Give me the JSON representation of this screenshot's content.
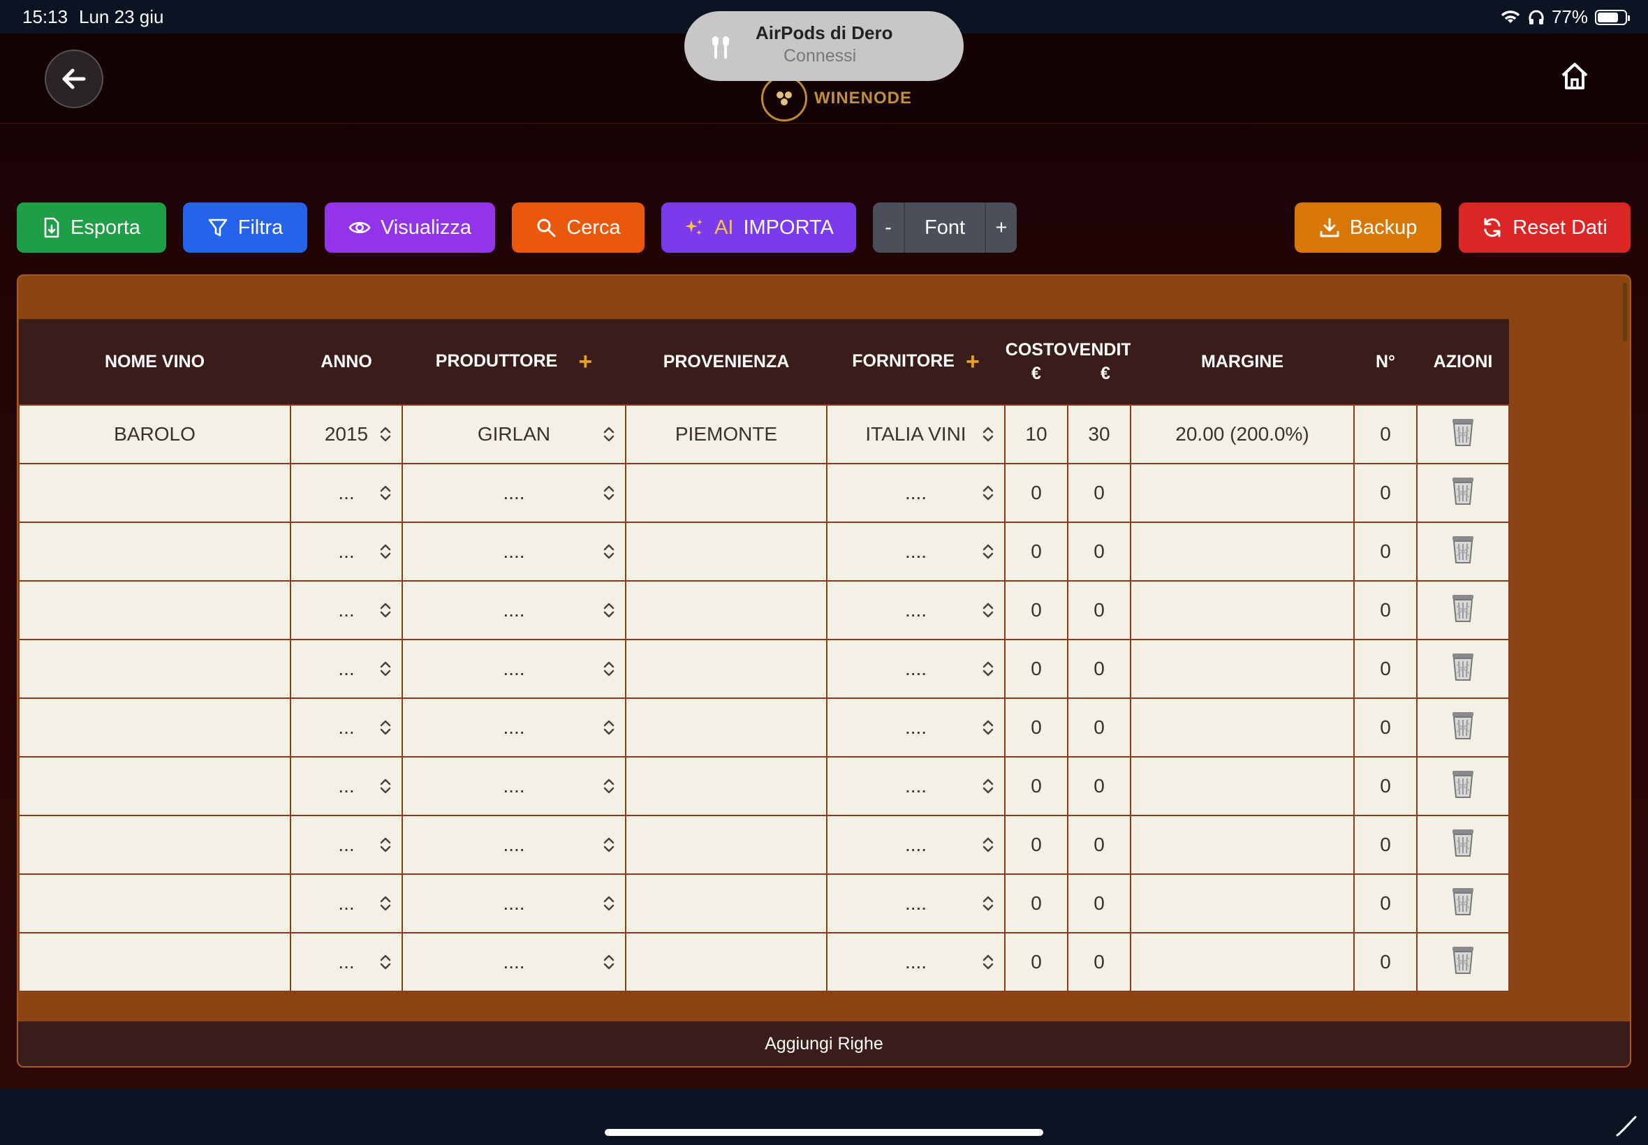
{
  "status_bar": {
    "time": "15:13",
    "date": "Lun 23 giu",
    "battery": "77%"
  },
  "notification": {
    "title": "AirPods di Dero",
    "subtitle": "Connessi"
  },
  "header": {
    "logo_text": "WINENODE"
  },
  "toolbar": {
    "export": "Esporta",
    "filter": "Filtra",
    "view": "Visualizza",
    "search": "Cerca",
    "ai_prefix": "AI",
    "import": "IMPORTA",
    "font_minus": "-",
    "font_label": "Font",
    "font_plus": "+",
    "backup": "Backup",
    "reset": "Reset Dati"
  },
  "colors": {
    "export": "#1e9e46",
    "filter": "#2563eb",
    "view": "#9333ea",
    "search": "#ea580c",
    "import": "#7c3aed",
    "backup": "#d97706",
    "reset": "#dc2626"
  },
  "table": {
    "headers": {
      "name": "NOME VINO",
      "year": "ANNO",
      "producer": "PRODUTTORE",
      "origin": "PROVENIENZA",
      "supplier": "FORNITORE",
      "cost_line1": "COSTO",
      "cost_line2": "€",
      "sale_line1": "VENDITA",
      "sale_line2": "€",
      "margin": "MARGINE",
      "qty": "N°",
      "actions": "AZIONI"
    },
    "add_symbol": "+",
    "rows": [
      {
        "name": "BAROLO",
        "year": "2015",
        "producer": "GIRLAN",
        "origin": "PIEMONTE",
        "supplier": "ITALIA VINI",
        "cost": "10",
        "sale": "30",
        "margin": "20.00 (200.0%)",
        "qty": "0"
      },
      {
        "name": "",
        "year": "...",
        "producer": "....",
        "origin": "",
        "supplier": "....",
        "cost": "0",
        "sale": "0",
        "margin": "",
        "qty": "0"
      },
      {
        "name": "",
        "year": "...",
        "producer": "....",
        "origin": "",
        "supplier": "....",
        "cost": "0",
        "sale": "0",
        "margin": "",
        "qty": "0"
      },
      {
        "name": "",
        "year": "...",
        "producer": "....",
        "origin": "",
        "supplier": "....",
        "cost": "0",
        "sale": "0",
        "margin": "",
        "qty": "0"
      },
      {
        "name": "",
        "year": "...",
        "producer": "....",
        "origin": "",
        "supplier": "....",
        "cost": "0",
        "sale": "0",
        "margin": "",
        "qty": "0"
      },
      {
        "name": "",
        "year": "...",
        "producer": "....",
        "origin": "",
        "supplier": "....",
        "cost": "0",
        "sale": "0",
        "margin": "",
        "qty": "0"
      },
      {
        "name": "",
        "year": "...",
        "producer": "....",
        "origin": "",
        "supplier": "....",
        "cost": "0",
        "sale": "0",
        "margin": "",
        "qty": "0"
      },
      {
        "name": "",
        "year": "...",
        "producer": "....",
        "origin": "",
        "supplier": "....",
        "cost": "0",
        "sale": "0",
        "margin": "",
        "qty": "0"
      },
      {
        "name": "",
        "year": "...",
        "producer": "....",
        "origin": "",
        "supplier": "....",
        "cost": "0",
        "sale": "0",
        "margin": "",
        "qty": "0"
      },
      {
        "name": "",
        "year": "...",
        "producer": "....",
        "origin": "",
        "supplier": "....",
        "cost": "0",
        "sale": "0",
        "margin": "",
        "qty": "0"
      }
    ]
  },
  "footer": {
    "add_rows": "Aggiungi Righe"
  }
}
